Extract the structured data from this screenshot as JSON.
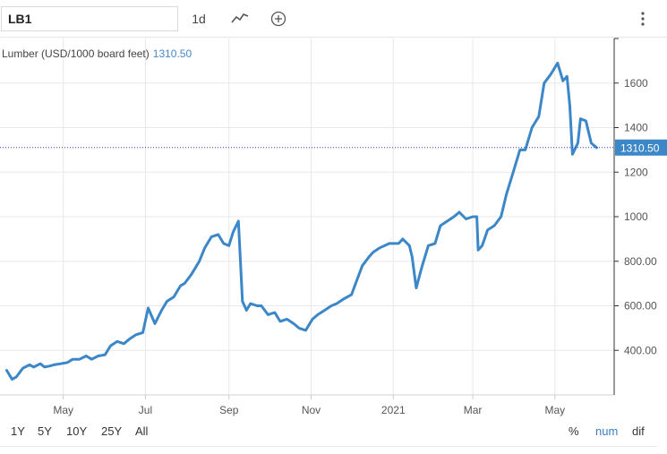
{
  "toolbar": {
    "symbol": "LB1",
    "interval": "1d",
    "linetype_icon": "line-chart-icon",
    "add_icon": "plus-circle-icon",
    "menu_icon": "vertical-dots-icon"
  },
  "chart_title": {
    "label": "Lumber (USD/1000 board feet)",
    "value": "1310.50"
  },
  "ranges": [
    "1Y",
    "5Y",
    "10Y",
    "25Y",
    "All"
  ],
  "modes": [
    "%",
    "num",
    "dif"
  ],
  "active_mode": "num",
  "colors": {
    "line": "#3c87c8",
    "last_price_line": "#3b3bd0",
    "tag_bg": "#3c87c8",
    "active_mode": "#3a7ebf"
  },
  "chart_data": {
    "type": "line",
    "series": [
      {
        "x": [
          "2020-03-20",
          "2020-03-24",
          "2020-03-27",
          "2020-04-01",
          "2020-04-06",
          "2020-04-09",
          "2020-04-14",
          "2020-04-17",
          "2020-04-21",
          "2020-04-24",
          "2020-04-29",
          "2020-05-04",
          "2020-05-08",
          "2020-05-13",
          "2020-05-18",
          "2020-05-22",
          "2020-05-27",
          "2020-06-01",
          "2020-06-05",
          "2020-06-10",
          "2020-06-15",
          "2020-06-19",
          "2020-06-24",
          "2020-06-29",
          "2020-07-03",
          "2020-07-08",
          "2020-07-13",
          "2020-07-17",
          "2020-07-22",
          "2020-07-24",
          "2020-07-27",
          "2020-07-30",
          "2020-08-04",
          "2020-08-10",
          "2020-08-14",
          "2020-08-19",
          "2020-08-24",
          "2020-08-28",
          "2020-09-01",
          "2020-09-04",
          "2020-09-08",
          "2020-09-11",
          "2020-09-14",
          "2020-09-17",
          "2020-09-22",
          "2020-09-25",
          "2020-09-30",
          "2020-10-05",
          "2020-10-09",
          "2020-10-14",
          "2020-10-19",
          "2020-10-23",
          "2020-10-28",
          "2020-11-02",
          "2020-11-06",
          "2020-11-11",
          "2020-11-16",
          "2020-11-20",
          "2020-11-25",
          "2020-12-01",
          "2020-12-04",
          "2020-12-09",
          "2020-12-14",
          "2020-12-17",
          "2020-12-22",
          "2020-12-29",
          "2021-01-05",
          "2021-01-08",
          "2021-01-13",
          "2021-01-15",
          "2021-01-18",
          "2021-01-22",
          "2021-01-27",
          "2021-02-01",
          "2021-02-05",
          "2021-02-10",
          "2021-02-15",
          "2021-02-19",
          "2021-02-24",
          "2021-03-01",
          "2021-03-04",
          "2021-03-05",
          "2021-03-08",
          "2021-03-12",
          "2021-03-17",
          "2021-03-22",
          "2021-03-26",
          "2021-03-31",
          "2021-04-05",
          "2021-04-09",
          "2021-04-14",
          "2021-04-19",
          "2021-04-23",
          "2021-04-28",
          "2021-05-03",
          "2021-05-07",
          "2021-05-10",
          "2021-05-12",
          "2021-05-14",
          "2021-05-18",
          "2021-05-20",
          "2021-05-24",
          "2021-05-26",
          "2021-05-28",
          "2021-06-01"
        ],
        "values": [
          310,
          270,
          280,
          320,
          335,
          325,
          340,
          325,
          330,
          335,
          340,
          345,
          360,
          360,
          375,
          360,
          375,
          380,
          420,
          440,
          430,
          450,
          470,
          480,
          590,
          520,
          580,
          620,
          640,
          660,
          690,
          700,
          740,
          800,
          860,
          910,
          920,
          880,
          870,
          930,
          980,
          620,
          580,
          610,
          600,
          600,
          560,
          570,
          530,
          540,
          520,
          500,
          490,
          540,
          560,
          580,
          600,
          610,
          630,
          650,
          700,
          780,
          820,
          840,
          860,
          880,
          880,
          900,
          870,
          820,
          680,
          770,
          870,
          880,
          960,
          980,
          1000,
          1020,
          990,
          1000,
          1000,
          850,
          870,
          940,
          960,
          1000,
          1100,
          1200,
          1300,
          1300,
          1400,
          1450,
          1600,
          1640,
          1690,
          1610,
          1630,
          1500,
          1280,
          1330,
          1440,
          1430,
          1380,
          1330,
          1310
        ]
      }
    ],
    "x_tick_labels": [
      "May",
      "Jul",
      "Sep",
      "Nov",
      "2021",
      "Mar",
      "May"
    ],
    "y_tick_labels": [
      "400.00",
      "600.00",
      "800.00",
      "1000",
      "1200",
      "1400",
      "1600"
    ],
    "y_ticks": [
      400,
      600,
      800,
      1000,
      1200,
      1400,
      1600
    ],
    "ylim": [
      200,
      1800
    ],
    "last_value": 1310.5,
    "last_value_label": "1310.50",
    "grid": true
  }
}
